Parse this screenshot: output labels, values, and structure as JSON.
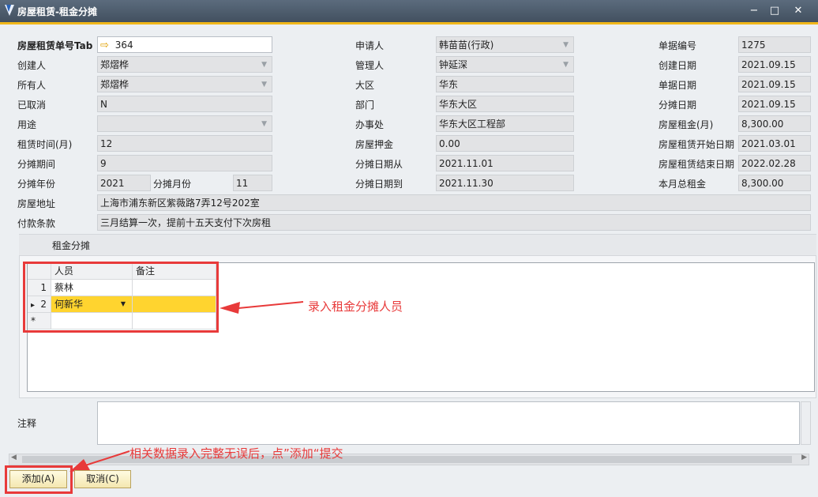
{
  "window": {
    "title": "房屋租赁-租金分摊",
    "minimize": "−",
    "maximize": "□",
    "close": "✕"
  },
  "form": {
    "left": [
      {
        "label": "房屋租赁单号Tab",
        "value": "364"
      },
      {
        "label": "创建人",
        "value": "郑熠桦"
      },
      {
        "label": "所有人",
        "value": "郑熠桦"
      },
      {
        "label": "已取消",
        "value": "N"
      },
      {
        "label": "用途",
        "value": ""
      },
      {
        "label": "租赁时间(月)",
        "value": "12"
      },
      {
        "label": "分摊期间",
        "value": "9"
      }
    ],
    "year_label": "分摊年份",
    "year_value": "2021",
    "month_label": "分摊月份",
    "month_value": "11",
    "address_label": "房屋地址",
    "address_value": "上海市浦东新区紫薇路7弄12号202室",
    "payment_label": "付款条款",
    "payment_value": "三月结算一次，提前十五天支付下次房租",
    "middle": [
      {
        "label": "申请人",
        "value": "韩苗苗(行政)"
      },
      {
        "label": "管理人",
        "value": "钟延深"
      },
      {
        "label": "大区",
        "value": "华东"
      },
      {
        "label": "部门",
        "value": "华东大区"
      },
      {
        "label": "办事处",
        "value": "华东大区工程部"
      },
      {
        "label": "房屋押金",
        "value": "0.00"
      },
      {
        "label": "分摊日期从",
        "value": "2021.11.01"
      },
      {
        "label": "分摊日期到",
        "value": "2021.11.30"
      }
    ],
    "right": [
      {
        "label": "单据编号",
        "value": "1275"
      },
      {
        "label": "创建日期",
        "value": "2021.09.15"
      },
      {
        "label": "单据日期",
        "value": "2021.09.15"
      },
      {
        "label": "分摊日期",
        "value": "2021.09.15"
      },
      {
        "label": "房屋租金(月)",
        "value": "8,300.00"
      },
      {
        "label": "房屋租赁开始日期",
        "value": "2021.03.01"
      },
      {
        "label": "房屋租赁结束日期",
        "value": "2022.02.28"
      },
      {
        "label": "本月总租金",
        "value": "8,300.00"
      }
    ]
  },
  "section": {
    "title": "租金分摊"
  },
  "grid": {
    "columns": [
      "人员",
      "备注"
    ],
    "rows": [
      {
        "num": "1",
        "person": "蔡林",
        "note": ""
      },
      {
        "num": "2",
        "person": "何新华",
        "note": ""
      }
    ],
    "new_row_marker": "*",
    "current_marker": "▸"
  },
  "notes": {
    "label": "注释",
    "value": ""
  },
  "annotations": {
    "grid_hint": "录入租金分摊人员",
    "submit_hint": "相关数据录入完整无误后，点”添加“提交"
  },
  "buttons": {
    "add": "添加(A)",
    "cancel": "取消(C)"
  },
  "colors": {
    "accent": "#f0b71a",
    "selection": "#ffd42f",
    "annotation": "#e83a3a"
  }
}
